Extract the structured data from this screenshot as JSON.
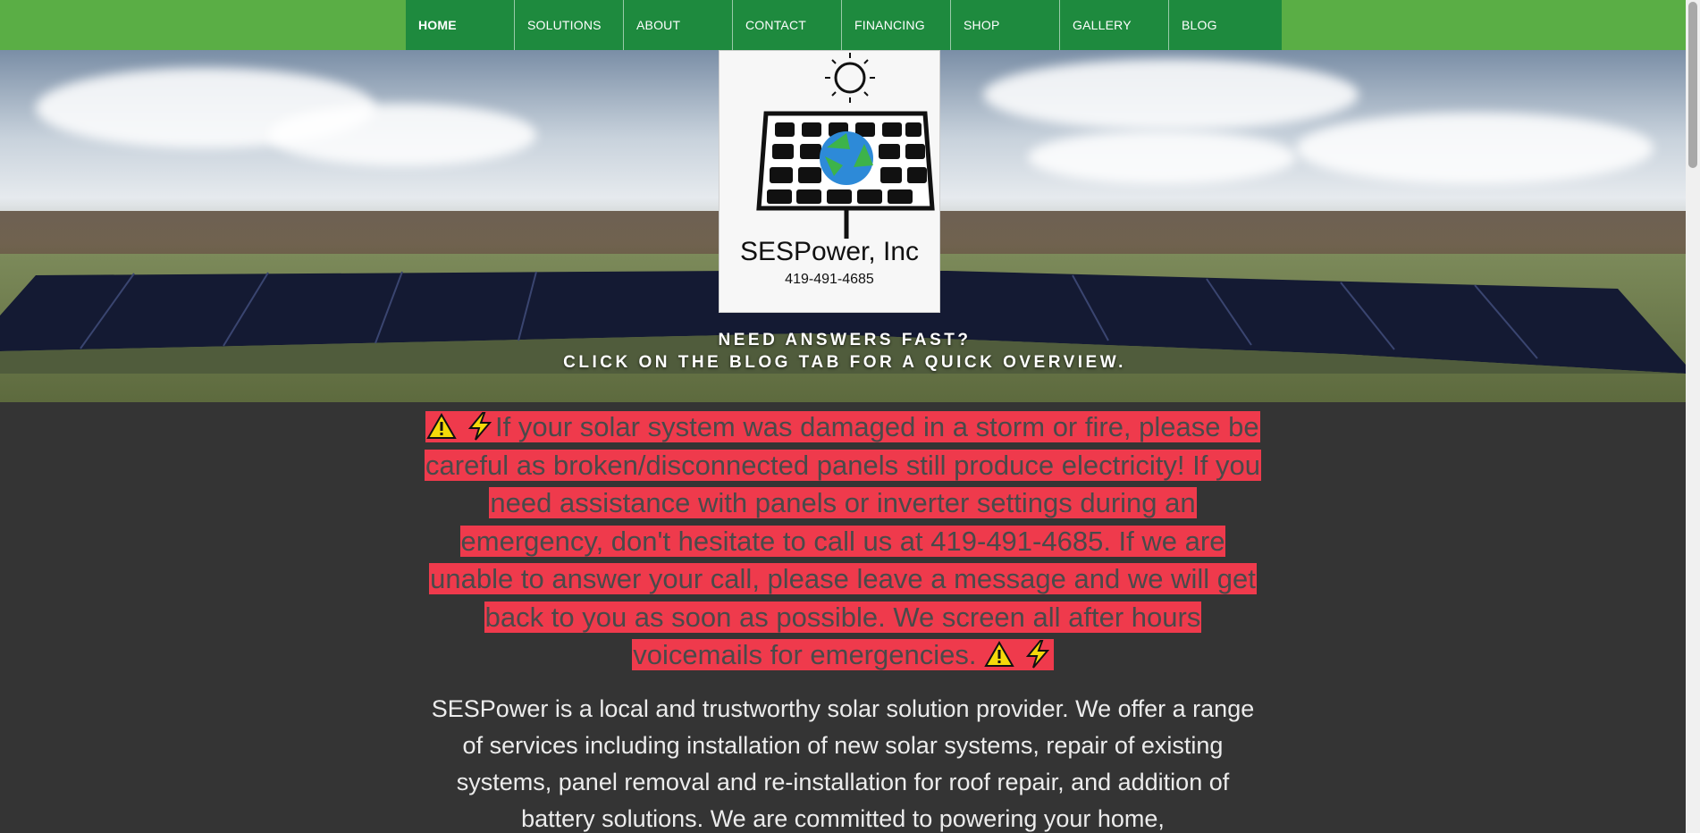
{
  "nav": {
    "items": [
      {
        "label": "HOME"
      },
      {
        "label": "SOLUTIONS"
      },
      {
        "label": "ABOUT"
      },
      {
        "label": "CONTACT"
      },
      {
        "label": "FINANCING"
      },
      {
        "label": "SHOP"
      },
      {
        "label": "GALLERY"
      },
      {
        "label": "BLOG"
      }
    ],
    "active": "HOME"
  },
  "logo": {
    "name": "SESPower, Inc",
    "phone": "419-491-4685"
  },
  "hero": {
    "line1": "NEED ANSWERS FAST?",
    "line2": "CLICK ON THE BLOG TAB FOR A QUICK OVERVIEW."
  },
  "alert": {
    "text": "If your solar system was damaged in a storm or fire, please be careful as broken/disconnected panels still produce electricity! If you need assistance with panels or inverter settings during an emergency, don't hesitate to call us at 419-491-4685. If we are unable to answer your call, please leave a message and we will get back to you as soon as possible. We screen all after hours voicemails for emergencies."
  },
  "intro": {
    "text": "SESPower is a local and trustworthy solar solution provider. We offer a range of services including installation of new solar systems, repair of existing systems, panel removal and re-installation for roof repair, and addition of battery solutions. We are committed to powering your home,"
  },
  "colors": {
    "nav_bg": "#1e8a3e",
    "topbar_bg": "#5aae45",
    "alert_bg": "#ef3a4c",
    "page_bg": "#343434"
  }
}
